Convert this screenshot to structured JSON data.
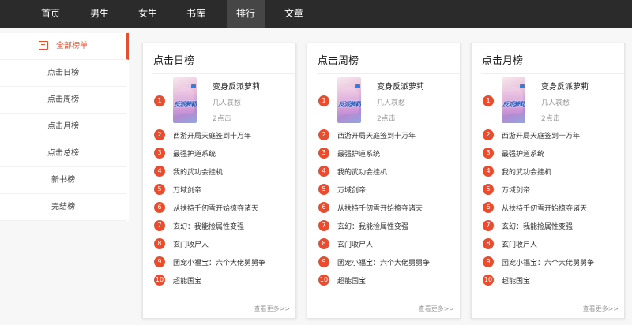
{
  "nav": [
    "首页",
    "男生",
    "女生",
    "书库",
    "排行",
    "文章"
  ],
  "sidebar": [
    {
      "label": "全部榜单"
    },
    {
      "label": "点击日榜"
    },
    {
      "label": "点击周榜"
    },
    {
      "label": "点击月榜"
    },
    {
      "label": "点击总榜"
    },
    {
      "label": "新书榜"
    },
    {
      "label": "完结榜"
    }
  ],
  "cards": [
    {
      "title": "点击日榜",
      "top_book": {
        "cover_text": "反派萝莉",
        "title": "变身反派萝莉",
        "author": "几人哀愁",
        "clicks": "2点击"
      },
      "ranks": [
        "1",
        "2",
        "3",
        "4",
        "5",
        "6",
        "7",
        "8",
        "9",
        "10"
      ],
      "list": [
        "西游开局天庭签到十万年",
        "最强护道系统",
        "我的武功会挂机",
        "万域剑帝",
        "从扶持千仞雪开始掠夺诸天",
        "玄幻：我能捡属性变强",
        "玄门收尸人",
        "团宠小福宝：六个大佬舅舅争",
        "超能国宝"
      ],
      "more": "查看更多>>"
    },
    {
      "title": "点击周榜",
      "top_book": {
        "cover_text": "反派萝莉",
        "title": "变身反派萝莉",
        "author": "几人哀愁",
        "clicks": "2点击"
      },
      "ranks": [
        "1",
        "2",
        "3",
        "4",
        "5",
        "6",
        "7",
        "8",
        "9",
        "10"
      ],
      "list": [
        "西游开局天庭签到十万年",
        "最强护道系统",
        "我的武功会挂机",
        "万域剑帝",
        "从扶持千仞雪开始掠夺诸天",
        "玄幻：我能捡属性变强",
        "玄门收尸人",
        "团宠小福宝：六个大佬舅舅争",
        "超能国宝"
      ],
      "more": "查看更多>>"
    },
    {
      "title": "点击月榜",
      "top_book": {
        "cover_text": "反派萝莉",
        "title": "变身反派萝莉",
        "author": "几人哀愁",
        "clicks": "2点击"
      },
      "ranks": [
        "1",
        "2",
        "3",
        "4",
        "5",
        "6",
        "7",
        "8",
        "9",
        "10"
      ],
      "list": [
        "西游开局天庭签到十万年",
        "最强护道系统",
        "我的武功会挂机",
        "万域剑帝",
        "从扶持千仞雪开始掠夺诸天",
        "玄幻：我能捡属性变强",
        "玄门收尸人",
        "团宠小福宝：六个大佬舅舅争",
        "超能国宝"
      ],
      "more": "查看更多>>"
    }
  ],
  "colors": {
    "accent": "#e84d2f",
    "nav_bg": "#2b2b2b",
    "nav_active_bg": "#464646"
  }
}
